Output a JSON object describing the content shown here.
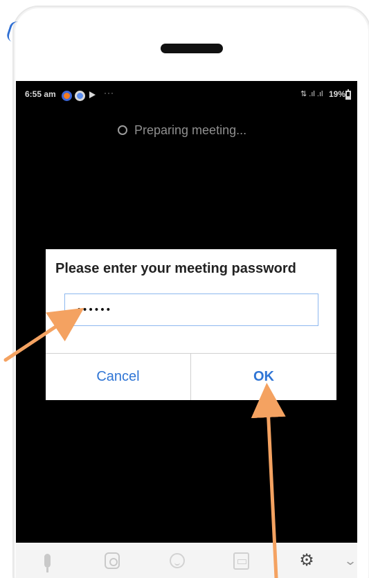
{
  "status_bar": {
    "time": "6:55 am",
    "more_indicator": "···",
    "network_text": "⇅ .ıl .ıl",
    "battery_text": "19%"
  },
  "meeting": {
    "status_text": "Preparing meeting..."
  },
  "password_dialog": {
    "title": "Please enter your meeting password",
    "password_value": "••••••",
    "cancel_label": "Cancel",
    "ok_label": "OK"
  },
  "toolbar": {
    "icons": [
      "microphone-icon",
      "video-camera-icon",
      "emoji-icon",
      "share-screen-icon",
      "settings-icon",
      "chevron-down-icon"
    ],
    "settings_glyph": "⚙",
    "chevron_glyph": "⌄"
  },
  "colors": {
    "phone_background": "#ffffff",
    "screen_background": "#000000",
    "dialog_background": "#ffffff",
    "button_text": "#2f75d5",
    "annotation_arrow": "#f4a261"
  }
}
